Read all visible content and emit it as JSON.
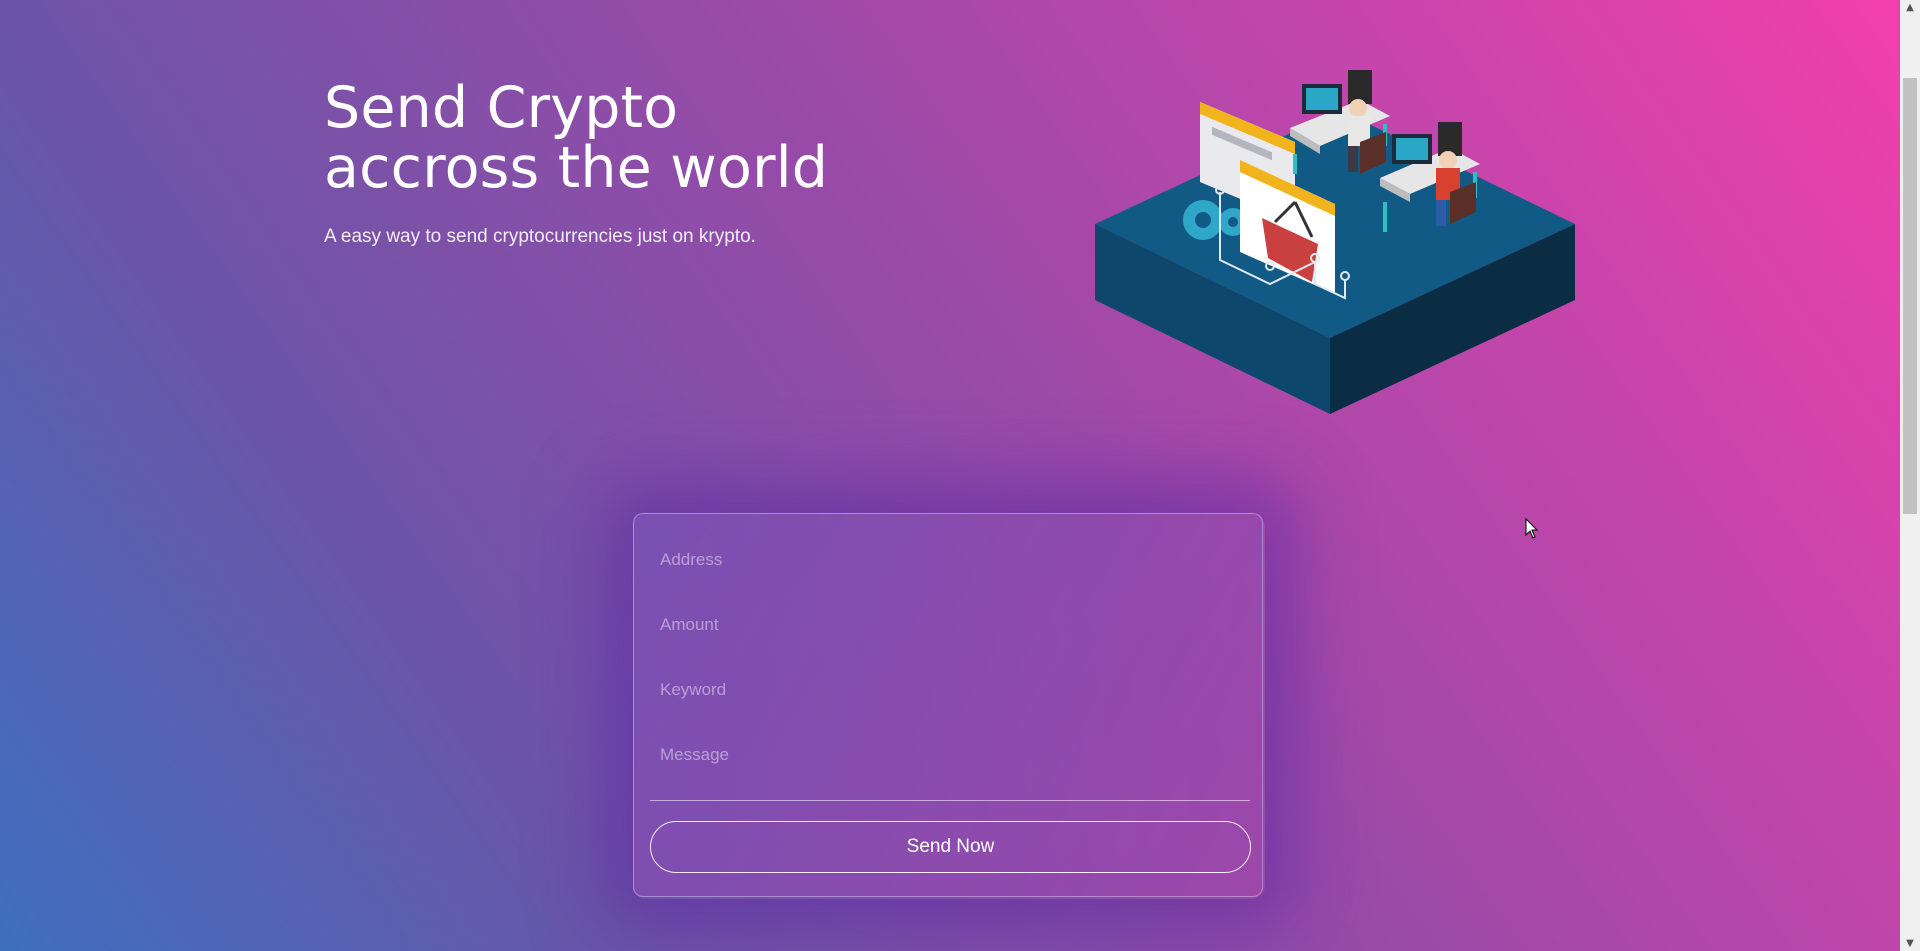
{
  "hero": {
    "title_line1": "Send Crypto",
    "title_line2": "accross the world",
    "subtitle": "A easy way to send cryptocurrencies just on krypto."
  },
  "form": {
    "address_placeholder": "Address",
    "amount_placeholder": "Amount",
    "keyword_placeholder": "Keyword",
    "message_placeholder": "Message",
    "submit_label": "Send Now"
  },
  "illustration": {
    "icon": "isometric-office-illustration"
  },
  "colors": {
    "gradient_start": "#3f6fbf",
    "gradient_mid": "#9b4aa8",
    "gradient_end": "#f43fab",
    "platform": "#0f4d73"
  }
}
